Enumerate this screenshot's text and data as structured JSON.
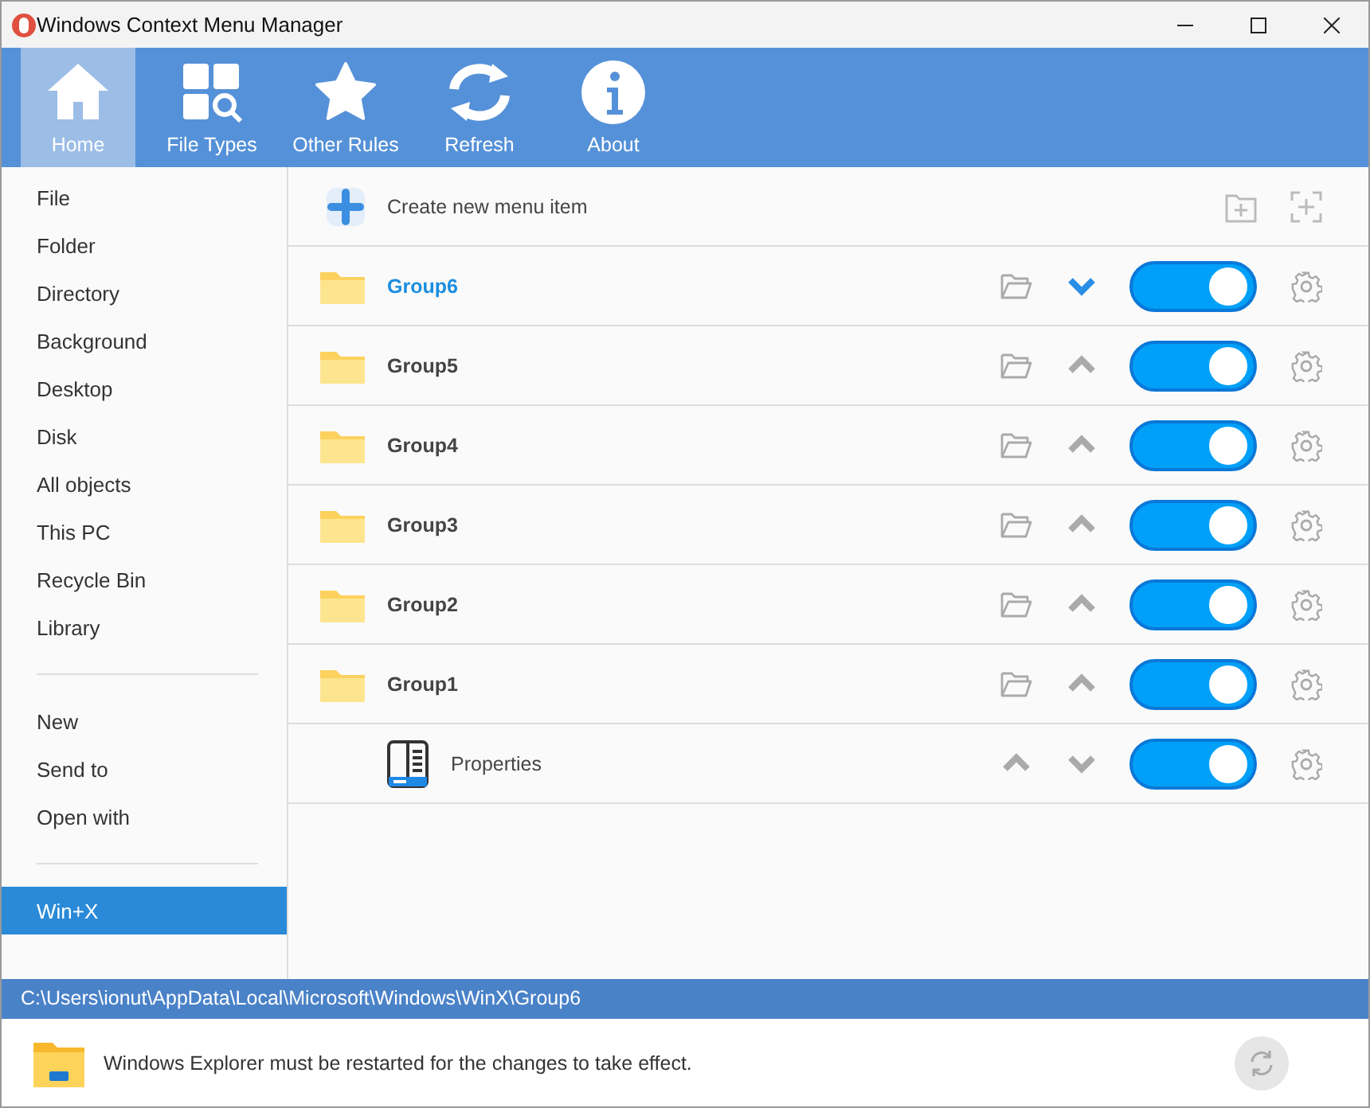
{
  "window": {
    "title": "Windows Context Menu Manager"
  },
  "toolbar": [
    {
      "label": "Home",
      "selected": true
    },
    {
      "label": "File Types",
      "selected": false
    },
    {
      "label": "Other Rules",
      "selected": false
    },
    {
      "label": "Refresh",
      "selected": false
    },
    {
      "label": "About",
      "selected": false
    }
  ],
  "sidebar": {
    "sections": [
      [
        {
          "label": "File",
          "selected": false
        },
        {
          "label": "Folder",
          "selected": false
        },
        {
          "label": "Directory",
          "selected": false
        },
        {
          "label": "Background",
          "selected": false
        },
        {
          "label": "Desktop",
          "selected": false
        },
        {
          "label": "Disk",
          "selected": false
        },
        {
          "label": "All objects",
          "selected": false
        },
        {
          "label": "This PC",
          "selected": false
        },
        {
          "label": "Recycle Bin",
          "selected": false
        },
        {
          "label": "Library",
          "selected": false
        }
      ],
      [
        {
          "label": "New",
          "selected": false
        },
        {
          "label": "Send to",
          "selected": false
        },
        {
          "label": "Open with",
          "selected": false
        }
      ],
      [
        {
          "label": "Win+X",
          "selected": true
        }
      ]
    ]
  },
  "create_item": {
    "label": "Create new menu item"
  },
  "rows": [
    {
      "kind": "group",
      "label": "Group6",
      "selected": true,
      "on": true,
      "actions": [
        {
          "kind": "open-folder"
        },
        {
          "kind": "down"
        }
      ]
    },
    {
      "kind": "group",
      "label": "Group5",
      "selected": false,
      "on": true,
      "actions": [
        {
          "kind": "open-folder"
        },
        {
          "kind": "up"
        }
      ]
    },
    {
      "kind": "group",
      "label": "Group4",
      "selected": false,
      "on": true,
      "actions": [
        {
          "kind": "open-folder"
        },
        {
          "kind": "up"
        }
      ]
    },
    {
      "kind": "group",
      "label": "Group3",
      "selected": false,
      "on": true,
      "actions": [
        {
          "kind": "open-folder"
        },
        {
          "kind": "up"
        }
      ]
    },
    {
      "kind": "group",
      "label": "Group2",
      "selected": false,
      "on": true,
      "actions": [
        {
          "kind": "open-folder"
        },
        {
          "kind": "up"
        }
      ]
    },
    {
      "kind": "group",
      "label": "Group1",
      "selected": false,
      "on": true,
      "actions": [
        {
          "kind": "open-folder"
        },
        {
          "kind": "up"
        }
      ]
    },
    {
      "kind": "item",
      "label": "Properties",
      "selected": false,
      "on": true,
      "actions": [
        {
          "kind": "up"
        },
        {
          "kind": "down"
        }
      ]
    }
  ],
  "status_bar": {
    "path": "C:\\Users\\ionut\\AppData\\Local\\Microsoft\\Windows\\WinX\\Group6"
  },
  "notice": {
    "text": "Windows Explorer must be restarted for the changes to take effect."
  }
}
